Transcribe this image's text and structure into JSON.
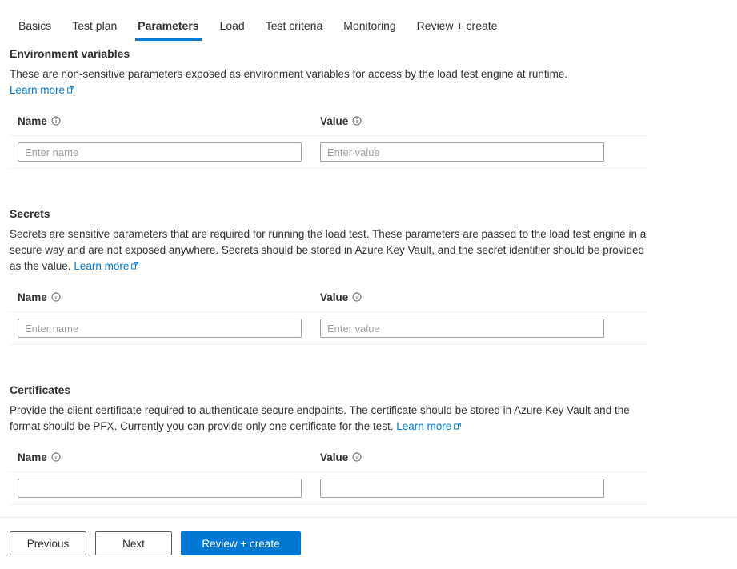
{
  "tabs": [
    {
      "label": "Basics",
      "active": false
    },
    {
      "label": "Test plan",
      "active": false
    },
    {
      "label": "Parameters",
      "active": true
    },
    {
      "label": "Load",
      "active": false
    },
    {
      "label": "Test criteria",
      "active": false
    },
    {
      "label": "Monitoring",
      "active": false
    },
    {
      "label": "Review + create",
      "active": false
    }
  ],
  "colors": {
    "accent": "#0078d4",
    "link": "#0078d4",
    "text": "#323130",
    "border": "#a19f9d",
    "row_divider": "#f3f2f1"
  },
  "common": {
    "learn_more": "Learn more",
    "name_label": "Name",
    "value_label": "Value",
    "name_placeholder": "Enter name",
    "value_placeholder": "Enter value",
    "info_icon": "info-circle-icon",
    "external_link_icon": "external-link-icon"
  },
  "sections": {
    "environment_variables": {
      "title": "Environment variables",
      "description": "These are non-sensitive parameters exposed as environment variables for access by the load test engine at runtime.",
      "link_text": "Learn more",
      "name_label": "Name",
      "value_label": "Value",
      "name_placeholder": "Enter name",
      "value_placeholder": "Enter value",
      "name_value": "",
      "value_value": ""
    },
    "secrets": {
      "title": "Secrets",
      "description": "Secrets are sensitive parameters that are required for running the load test. These parameters are passed to the load test engine in a secure way and are not exposed anywhere. Secrets should be stored in Azure Key Vault, and the secret identifier should be provided as the value.",
      "link_text": "Learn more",
      "name_label": "Name",
      "value_label": "Value",
      "name_placeholder": "Enter name",
      "value_placeholder": "Enter value",
      "name_value": "",
      "value_value": ""
    },
    "certificates": {
      "title": "Certificates",
      "description": "Provide the client certificate required to authenticate secure endpoints. The certificate should be stored in Azure Key Vault and the format should be PFX. Currently you can provide only one certificate for the test.",
      "link_text": "Learn more",
      "name_label": "Name",
      "value_label": "Value",
      "name_placeholder": "",
      "value_placeholder": "",
      "name_value": "",
      "value_value": ""
    }
  },
  "footer": {
    "previous_label": "Previous",
    "next_label": "Next",
    "review_create_label": "Review + create"
  }
}
